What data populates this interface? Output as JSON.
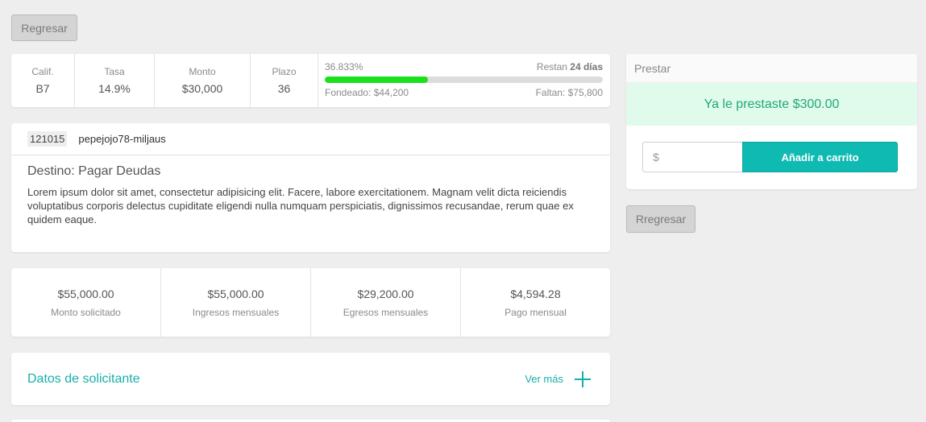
{
  "top": {
    "back_label": "Regresar"
  },
  "stats": [
    {
      "label": "Calif.",
      "value": "B7"
    },
    {
      "label": "Tasa",
      "value": "14.9%"
    },
    {
      "label": "Monto",
      "value": "$30,000"
    },
    {
      "label": "Plazo",
      "value": "36"
    }
  ],
  "progress": {
    "percent_text": "36.833%",
    "remaining_prefix": "Restan",
    "remaining_days": "24 días",
    "funded_text": "Fondeado: $44,200",
    "missing_text": "Faltan: $75,800",
    "fill_fraction": 0.37,
    "fill_color": "#1de01d"
  },
  "detail": {
    "loan_id": "121015",
    "username": "pepejojo78-miljaus",
    "title": "Destino: Pagar Deudas",
    "description": "Lorem ipsum dolor sit amet, consectetur adipisicing elit. Facere, labore exercitationem. Magnam velit dicta reiciendis voluptatibus corporis delectus cupiditate eligendi nulla numquam perspiciatis, dignissimos recusandae, rerum quae ex quidem eaque."
  },
  "finance": [
    {
      "value": "$55,000.00",
      "label": "Monto solicitado"
    },
    {
      "value": "$55,000.00",
      "label": "Ingresos mensuales"
    },
    {
      "value": "$29,200.00",
      "label": "Egresos mensuales"
    },
    {
      "value": "$4,594.28",
      "label": "Pago mensual"
    }
  ],
  "applicant": {
    "title": "Datos de solicitante",
    "more_label": "Ver más",
    "icon": "plus-icon"
  },
  "lend": {
    "header": "Prestar",
    "message": "Ya le prestaste $300.00",
    "currency_symbol": "$",
    "amount_placeholder": "",
    "add_cart_label": "Añadir a carrito"
  },
  "side": {
    "back_label": "Rregresar"
  },
  "colors": {
    "accent": "#17b0a8",
    "cart_button": "#0fbab3",
    "success_bg": "#e0fbeb"
  }
}
